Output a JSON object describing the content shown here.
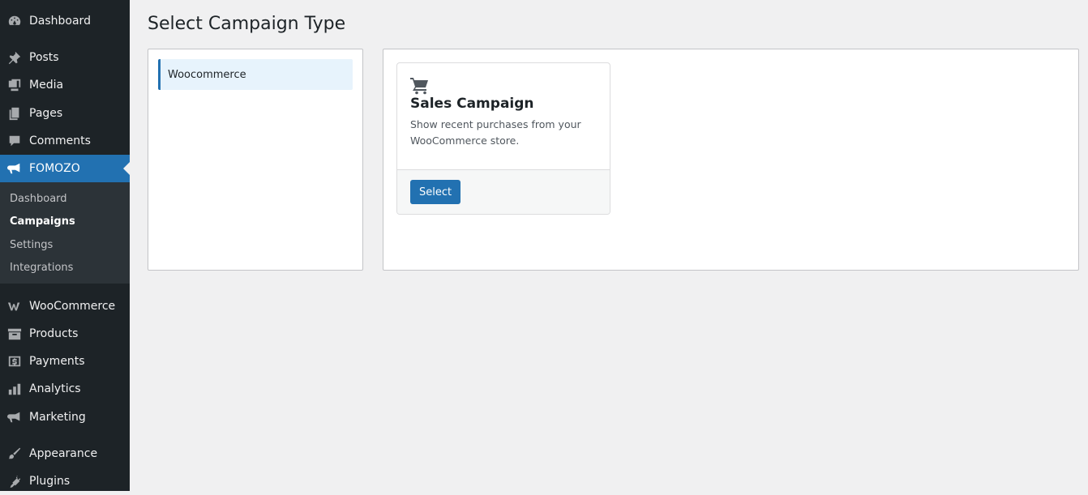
{
  "sidebar": {
    "items": [
      {
        "label": "Dashboard",
        "icon": "dashboard-icon"
      },
      {
        "label": "Posts",
        "icon": "pushpin-icon"
      },
      {
        "label": "Media",
        "icon": "media-icon"
      },
      {
        "label": "Pages",
        "icon": "pages-icon"
      },
      {
        "label": "Comments",
        "icon": "comment-icon"
      },
      {
        "label": "FOMOZO",
        "icon": "megaphone-icon"
      },
      {
        "label": "WooCommerce",
        "icon": "woocommerce-icon"
      },
      {
        "label": "Products",
        "icon": "archive-box-icon"
      },
      {
        "label": "Payments",
        "icon": "dollar-icon"
      },
      {
        "label": "Analytics",
        "icon": "bar-chart-icon"
      },
      {
        "label": "Marketing",
        "icon": "megaphone-icon"
      },
      {
        "label": "Appearance",
        "icon": "paintbrush-icon"
      },
      {
        "label": "Plugins",
        "icon": "plug-icon"
      }
    ],
    "submenu": [
      {
        "label": "Dashboard"
      },
      {
        "label": "Campaigns"
      },
      {
        "label": "Settings"
      },
      {
        "label": "Integrations"
      }
    ]
  },
  "main": {
    "title": "Select Campaign Type",
    "types": [
      {
        "label": "Woocommerce"
      }
    ],
    "cards": [
      {
        "icon": "cart-icon",
        "title": "Sales Campaign",
        "description": "Show recent purchases from your WooCommerce store.",
        "button": "Select"
      }
    ]
  },
  "colors": {
    "sidebar_bg": "#1d2327",
    "submenu_bg": "#2c3338",
    "accent": "#2271b1",
    "page_bg": "#f0f0f1"
  }
}
